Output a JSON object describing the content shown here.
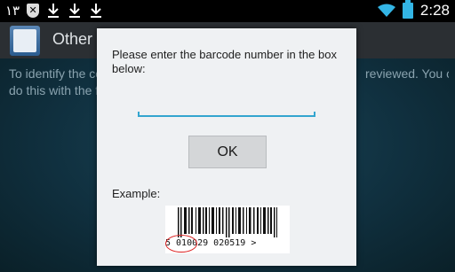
{
  "status_bar": {
    "left_glyph": "١٣",
    "time": "2:28",
    "icons": [
      "shield-x-icon",
      "download-icon",
      "download-icon",
      "download-icon",
      "wifi-icon",
      "battery-icon"
    ]
  },
  "action_bar": {
    "title": "Other F"
  },
  "background": {
    "line1_left": "To identify the co",
    "line1_right": "reviewed. You can",
    "line2": "do this with the f"
  },
  "dialog": {
    "prompt": "Please enter the barcode number in the box below:",
    "input_value": "",
    "ok_label": "OK",
    "example_label": "Example:",
    "barcode_digits": "5 010029 020519 >"
  },
  "colors": {
    "accent": "#33a5cf",
    "dialog_bg": "#eff1f3",
    "highlight_circle": "#d22222"
  }
}
